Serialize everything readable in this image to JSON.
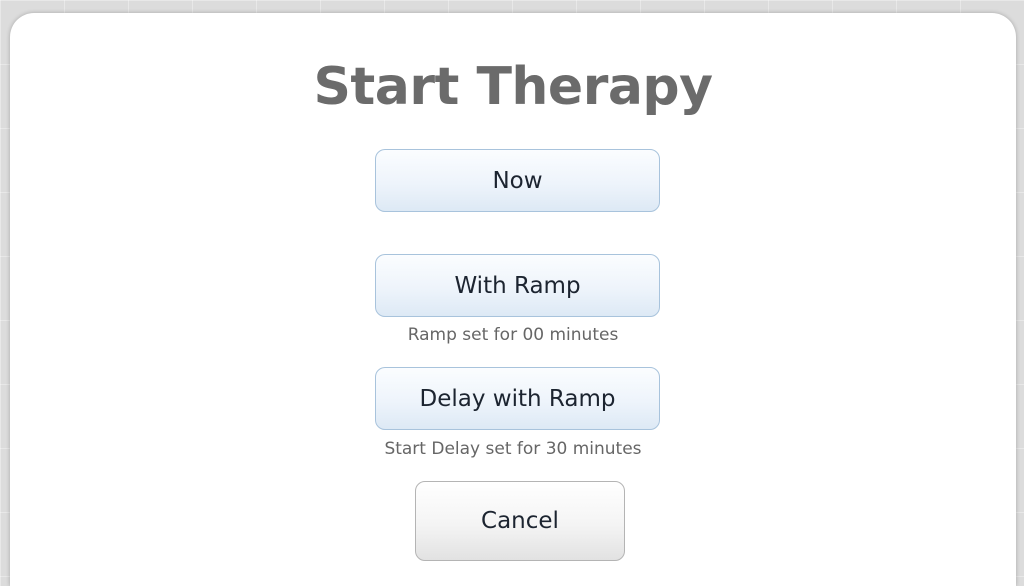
{
  "dialog": {
    "title": "Start Therapy",
    "buttons": {
      "now": "Now",
      "with_ramp": "With Ramp",
      "delay_with_ramp": "Delay with Ramp",
      "cancel": "Cancel"
    },
    "captions": {
      "ramp": "Ramp set for 00 minutes",
      "delay": "Start Delay set for 30 minutes"
    }
  },
  "colors": {
    "title": "#6b6b6b",
    "button_border": "#a8c3dc",
    "button_fill_top": "#fbfdff",
    "button_fill_bottom": "#dde9f5",
    "cancel_border": "#b4b4b4",
    "caption_text": "#666666"
  }
}
